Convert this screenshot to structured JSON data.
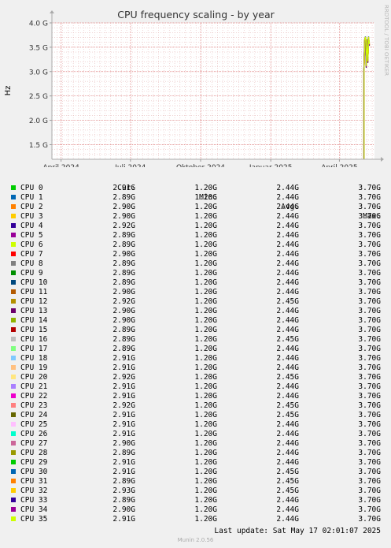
{
  "chart_data": {
    "type": "line",
    "title": "CPU frequency scaling - by year",
    "ylabel": "Hz",
    "xlabel": "",
    "x_ticks": [
      {
        "label": "April 2024",
        "date": "2024-04-01"
      },
      {
        "label": "Juli 2024",
        "date": "2024-07-01"
      },
      {
        "label": "Oktober 2024",
        "date": "2024-10-01"
      },
      {
        "label": "Januar 2025",
        "date": "2025-01-01"
      },
      {
        "label": "April 2025",
        "date": "2025-04-01"
      }
    ],
    "y_ticks": [
      {
        "label": "1.5 G",
        "value": 1.5
      },
      {
        "label": "2.0 G",
        "value": 2.0
      },
      {
        "label": "2.5 G",
        "value": 2.5
      },
      {
        "label": "3.0 G",
        "value": 3.0
      },
      {
        "label": "3.5 G",
        "value": 3.5
      },
      {
        "label": "4.0 G",
        "value": 4.0
      }
    ],
    "xlim": [
      "2024-03-20",
      "2025-05-17"
    ],
    "ylim": [
      1.2,
      4.0
    ],
    "y_unit": "GHz",
    "grid": true,
    "series_envelope": {
      "x": [
        "2025-05-03",
        "2025-05-03",
        "2025-05-04",
        "2025-05-05",
        "2025-05-06",
        "2025-05-07",
        "2025-05-08",
        "2025-05-09",
        "2025-05-10"
      ],
      "y": [
        1.2,
        3.05,
        3.65,
        3.7,
        3.1,
        3.65,
        3.2,
        3.7,
        3.55
      ]
    },
    "legend_columns": [
      "Cur:",
      "Min:",
      "Avg:",
      "Max:"
    ],
    "series": [
      {
        "name": "CPU 0",
        "color": "#00cc00",
        "cur": "2.91G",
        "min": "1.20G",
        "avg": "2.44G",
        "max": "3.70G"
      },
      {
        "name": "CPU 1",
        "color": "#0066b3",
        "cur": "2.89G",
        "min": "1.20G",
        "avg": "2.44G",
        "max": "3.70G"
      },
      {
        "name": "CPU 2",
        "color": "#ff8000",
        "cur": "2.90G",
        "min": "1.20G",
        "avg": "2.44G",
        "max": "3.70G"
      },
      {
        "name": "CPU 3",
        "color": "#ffcc00",
        "cur": "2.90G",
        "min": "1.20G",
        "avg": "2.44G",
        "max": "3.70G"
      },
      {
        "name": "CPU 4",
        "color": "#330099",
        "cur": "2.92G",
        "min": "1.20G",
        "avg": "2.44G",
        "max": "3.70G"
      },
      {
        "name": "CPU 5",
        "color": "#990099",
        "cur": "2.89G",
        "min": "1.20G",
        "avg": "2.44G",
        "max": "3.70G"
      },
      {
        "name": "CPU 6",
        "color": "#ccff00",
        "cur": "2.89G",
        "min": "1.20G",
        "avg": "2.44G",
        "max": "3.70G"
      },
      {
        "name": "CPU 7",
        "color": "#ff0000",
        "cur": "2.90G",
        "min": "1.20G",
        "avg": "2.44G",
        "max": "3.70G"
      },
      {
        "name": "CPU 8",
        "color": "#808080",
        "cur": "2.89G",
        "min": "1.20G",
        "avg": "2.44G",
        "max": "3.70G"
      },
      {
        "name": "CPU 9",
        "color": "#008f00",
        "cur": "2.89G",
        "min": "1.20G",
        "avg": "2.44G",
        "max": "3.70G"
      },
      {
        "name": "CPU 10",
        "color": "#00487d",
        "cur": "2.89G",
        "min": "1.20G",
        "avg": "2.44G",
        "max": "3.70G"
      },
      {
        "name": "CPU 11",
        "color": "#b35a00",
        "cur": "2.90G",
        "min": "1.20G",
        "avg": "2.44G",
        "max": "3.70G"
      },
      {
        "name": "CPU 12",
        "color": "#b38f00",
        "cur": "2.92G",
        "min": "1.20G",
        "avg": "2.45G",
        "max": "3.70G"
      },
      {
        "name": "CPU 13",
        "color": "#6b006b",
        "cur": "2.90G",
        "min": "1.20G",
        "avg": "2.44G",
        "max": "3.70G"
      },
      {
        "name": "CPU 14",
        "color": "#8fb300",
        "cur": "2.90G",
        "min": "1.20G",
        "avg": "2.44G",
        "max": "3.70G"
      },
      {
        "name": "CPU 15",
        "color": "#b30000",
        "cur": "2.89G",
        "min": "1.20G",
        "avg": "2.44G",
        "max": "3.70G"
      },
      {
        "name": "CPU 16",
        "color": "#bebebe",
        "cur": "2.89G",
        "min": "1.20G",
        "avg": "2.45G",
        "max": "3.70G"
      },
      {
        "name": "CPU 17",
        "color": "#80ff80",
        "cur": "2.89G",
        "min": "1.20G",
        "avg": "2.44G",
        "max": "3.70G"
      },
      {
        "name": "CPU 18",
        "color": "#80c9ff",
        "cur": "2.91G",
        "min": "1.20G",
        "avg": "2.44G",
        "max": "3.70G"
      },
      {
        "name": "CPU 19",
        "color": "#ffc080",
        "cur": "2.91G",
        "min": "1.20G",
        "avg": "2.44G",
        "max": "3.70G"
      },
      {
        "name": "CPU 20",
        "color": "#ffe680",
        "cur": "2.92G",
        "min": "1.20G",
        "avg": "2.45G",
        "max": "3.70G"
      },
      {
        "name": "CPU 21",
        "color": "#aa80ff",
        "cur": "2.91G",
        "min": "1.20G",
        "avg": "2.44G",
        "max": "3.70G"
      },
      {
        "name": "CPU 22",
        "color": "#ee00cc",
        "cur": "2.91G",
        "min": "1.20G",
        "avg": "2.44G",
        "max": "3.70G"
      },
      {
        "name": "CPU 23",
        "color": "#ff8080",
        "cur": "2.92G",
        "min": "1.20G",
        "avg": "2.45G",
        "max": "3.70G"
      },
      {
        "name": "CPU 24",
        "color": "#666600",
        "cur": "2.91G",
        "min": "1.20G",
        "avg": "2.45G",
        "max": "3.70G"
      },
      {
        "name": "CPU 25",
        "color": "#ffbfff",
        "cur": "2.91G",
        "min": "1.20G",
        "avg": "2.44G",
        "max": "3.70G"
      },
      {
        "name": "CPU 26",
        "color": "#00ffcc",
        "cur": "2.91G",
        "min": "1.20G",
        "avg": "2.44G",
        "max": "3.70G"
      },
      {
        "name": "CPU 27",
        "color": "#cc6699",
        "cur": "2.90G",
        "min": "1.20G",
        "avg": "2.44G",
        "max": "3.70G"
      },
      {
        "name": "CPU 28",
        "color": "#999900",
        "cur": "2.89G",
        "min": "1.20G",
        "avg": "2.44G",
        "max": "3.70G"
      },
      {
        "name": "CPU 29",
        "color": "#00cc00",
        "cur": "2.91G",
        "min": "1.20G",
        "avg": "2.44G",
        "max": "3.70G"
      },
      {
        "name": "CPU 30",
        "color": "#0066b3",
        "cur": "2.91G",
        "min": "1.20G",
        "avg": "2.45G",
        "max": "3.70G"
      },
      {
        "name": "CPU 31",
        "color": "#ff8000",
        "cur": "2.89G",
        "min": "1.20G",
        "avg": "2.45G",
        "max": "3.70G"
      },
      {
        "name": "CPU 32",
        "color": "#ffcc00",
        "cur": "2.93G",
        "min": "1.20G",
        "avg": "2.45G",
        "max": "3.70G"
      },
      {
        "name": "CPU 33",
        "color": "#330099",
        "cur": "2.89G",
        "min": "1.20G",
        "avg": "2.44G",
        "max": "3.70G"
      },
      {
        "name": "CPU 34",
        "color": "#990099",
        "cur": "2.90G",
        "min": "1.20G",
        "avg": "2.44G",
        "max": "3.70G"
      },
      {
        "name": "CPU 35",
        "color": "#ccff00",
        "cur": "2.91G",
        "min": "1.20G",
        "avg": "2.44G",
        "max": "3.70G"
      }
    ]
  },
  "last_update": "Last update: Sat May 17 02:01:07 2025",
  "footer": "Munin 2.0.56",
  "side_label": "RRDTOOL / TOBI OETIKER"
}
